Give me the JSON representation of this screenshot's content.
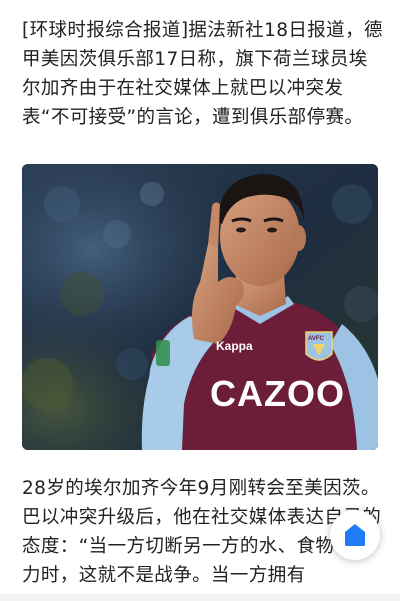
{
  "article": {
    "paragraph_1": "[环球时报综合报道]据法新社18日报道，德甲美因茨俱乐部17日称，旗下荷兰球员埃尔加齐由于在社交媒体上就巴以冲突发表“不可接受”的言论，遭到俱乐部停赛。",
    "paragraph_2": "28岁的埃尔加齐今年9月刚转会至美因茨。巴以冲突升级后，他在社交媒体表达自己的态度：“当一方切断另一方的水、食物和电力时，这就不是战争。当一方拥有",
    "photo": {
      "sponsor_text": "CAZOO",
      "badge_text": "AVFC",
      "kit_brand": "Kappa",
      "colors": {
        "claret": "#6b1d3a",
        "sky_blue": "#9cc3e4",
        "skin": "#c98d6c",
        "hair": "#1a1512"
      }
    },
    "float_button_icon": "home-icon",
    "accent_color": "#1f7cf6"
  }
}
